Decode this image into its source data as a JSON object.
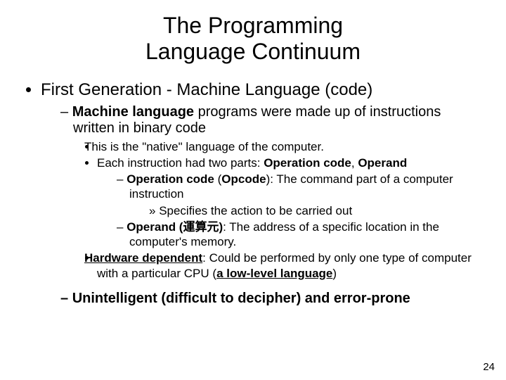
{
  "title_line1": "The Programming",
  "title_line2": "Language Continuum",
  "top_bullet": "First Generation - Machine Language (code)",
  "dash1_a": "Machine language",
  "dash1_b": " programs were made up of instructions written in binary code",
  "sb1": "This is the \"native\" language of the computer.",
  "sb2_a": "Each instruction had two parts: ",
  "sb2_b": "Operation code",
  "sb2_c": ", ",
  "sb2_d": "Operand",
  "sd1_a": "Operation code",
  "sd1_b": " (",
  "sd1_c": "Opcode",
  "sd1_d": "): The command part of a computer instruction",
  "chev1": "Specifies the action to be carried out",
  "sd2_a": "Operand (",
  "sd2_b": "運算元",
  "sd2_c": ")",
  "sd2_d": ": The address of a specific location in the computer's memory.",
  "sb3_a": "Hardware dependent",
  "sb3_b": ": Could be performed by only one type of computer with a particular CPU (",
  "sb3_c": "a low-level language",
  "sb3_d": ")",
  "dash2": "Unintelligent (difficult to decipher) and error-prone",
  "page_number": "24"
}
